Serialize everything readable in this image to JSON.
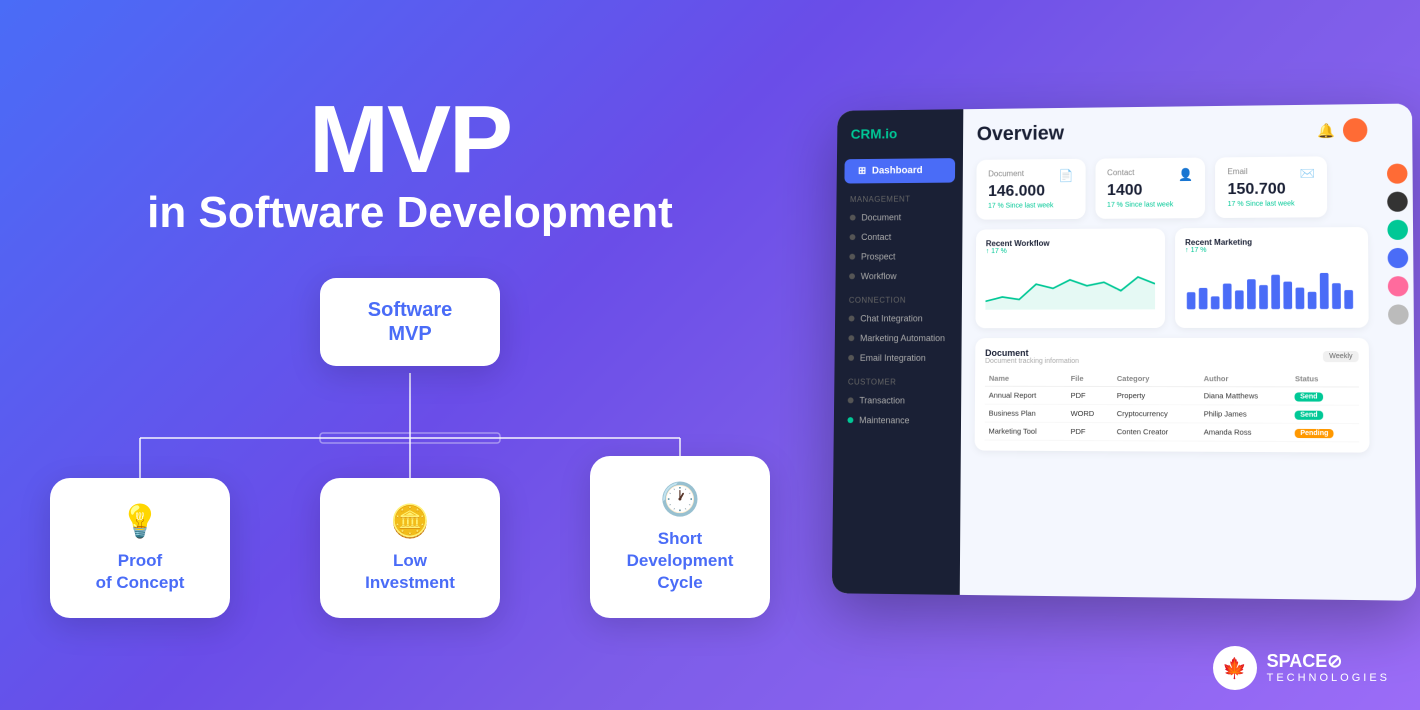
{
  "header": {
    "title_main": "MVP",
    "title_sub": "in Software Development"
  },
  "diagram": {
    "center_label_line1": "Software",
    "center_label_line2": "MVP",
    "box1_label": "Proof\nof Concept",
    "box2_label": "Low\nInvestment",
    "box3_label": "Short\nDevelopment Cycle",
    "box1_icon": "💡",
    "box2_icon": "🪙",
    "box3_icon": "🕐"
  },
  "crm": {
    "logo": "CRM.io",
    "header_title": "Overview",
    "nav_active": "Dashboard",
    "sections": [
      {
        "title": "Management",
        "items": [
          "Document",
          "Contact",
          "Prospect",
          "Workflow"
        ]
      },
      {
        "title": "Connection",
        "items": [
          "Chat Integration",
          "Marketing Automation",
          "Email Integration"
        ]
      },
      {
        "title": "Customer",
        "items": [
          "Transaction",
          "Maintenance"
        ]
      }
    ],
    "stats": [
      {
        "label": "Document",
        "value": "146.000",
        "change": "17 %  Since last week"
      },
      {
        "label": "Contact",
        "value": "1400",
        "change": "17 %  Since last week"
      },
      {
        "label": "Email",
        "value": "150.700",
        "change": "17 %  Since last week"
      }
    ],
    "chart_workflow_title": "Recent Workflow",
    "chart_workflow_change": "17 %",
    "chart_marketing_title": "Recent Marketing",
    "chart_marketing_change": "17 %",
    "table_title": "Document",
    "table_sub": "Document tracking information",
    "table_weekly": "Weekly",
    "table_headers": [
      "Name",
      "File",
      "Category",
      "Author",
      "Status"
    ],
    "table_rows": [
      {
        "name": "Annual Report",
        "file": "PDF",
        "category": "Property",
        "author": "Diana Matthews",
        "status": "Send",
        "badge": "send"
      },
      {
        "name": "Business Plan",
        "file": "WORD",
        "category": "Cryptocurrency",
        "author": "Philip James",
        "status": "Send",
        "badge": "send"
      },
      {
        "name": "Marketing Tool",
        "file": "PDF",
        "category": "Conten Creator",
        "author": "Amanda Ross",
        "status": "Pending",
        "badge": "pending"
      }
    ]
  },
  "logo": {
    "icon": "🍁",
    "name": "SPACE⊘",
    "sub": "TECHNOLOGIES"
  }
}
